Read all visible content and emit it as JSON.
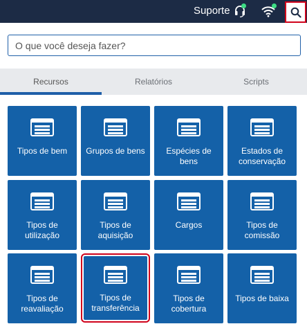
{
  "topbar": {
    "support_label": "Suporte",
    "headset_icon": "headset-icon",
    "wifi_icon": "wifi-icon",
    "search_icon": "search-icon",
    "status_color": "#3ddc84",
    "bg_color": "#1c2b45",
    "highlight_color": "#d0021b"
  },
  "search": {
    "placeholder": "O que você deseja fazer?",
    "value": ""
  },
  "tabs": [
    {
      "label": "Recursos",
      "active": true
    },
    {
      "label": "Relatórios",
      "active": false
    },
    {
      "label": "Scripts",
      "active": false
    }
  ],
  "tiles": [
    {
      "label": "Tipos de bem",
      "icon": "list-icon"
    },
    {
      "label": "Grupos de bens",
      "icon": "list-icon"
    },
    {
      "label": "Espécies de bens",
      "icon": "list-icon"
    },
    {
      "label": "Estados de conservação",
      "icon": "list-icon"
    },
    {
      "label": "Tipos de utilização",
      "icon": "list-icon"
    },
    {
      "label": "Tipos de aquisição",
      "icon": "list-icon"
    },
    {
      "label": "Cargos",
      "icon": "list-icon"
    },
    {
      "label": "Tipos de comissão",
      "icon": "list-icon"
    },
    {
      "label": "Tipos de reavaliação",
      "icon": "list-icon"
    },
    {
      "label": "Tipos de transferência",
      "icon": "list-icon",
      "highlighted": true
    },
    {
      "label": "Tipos de cobertura",
      "icon": "list-icon"
    },
    {
      "label": "Tipos de baixa",
      "icon": "list-icon"
    }
  ],
  "tile_color": "#1461a8"
}
